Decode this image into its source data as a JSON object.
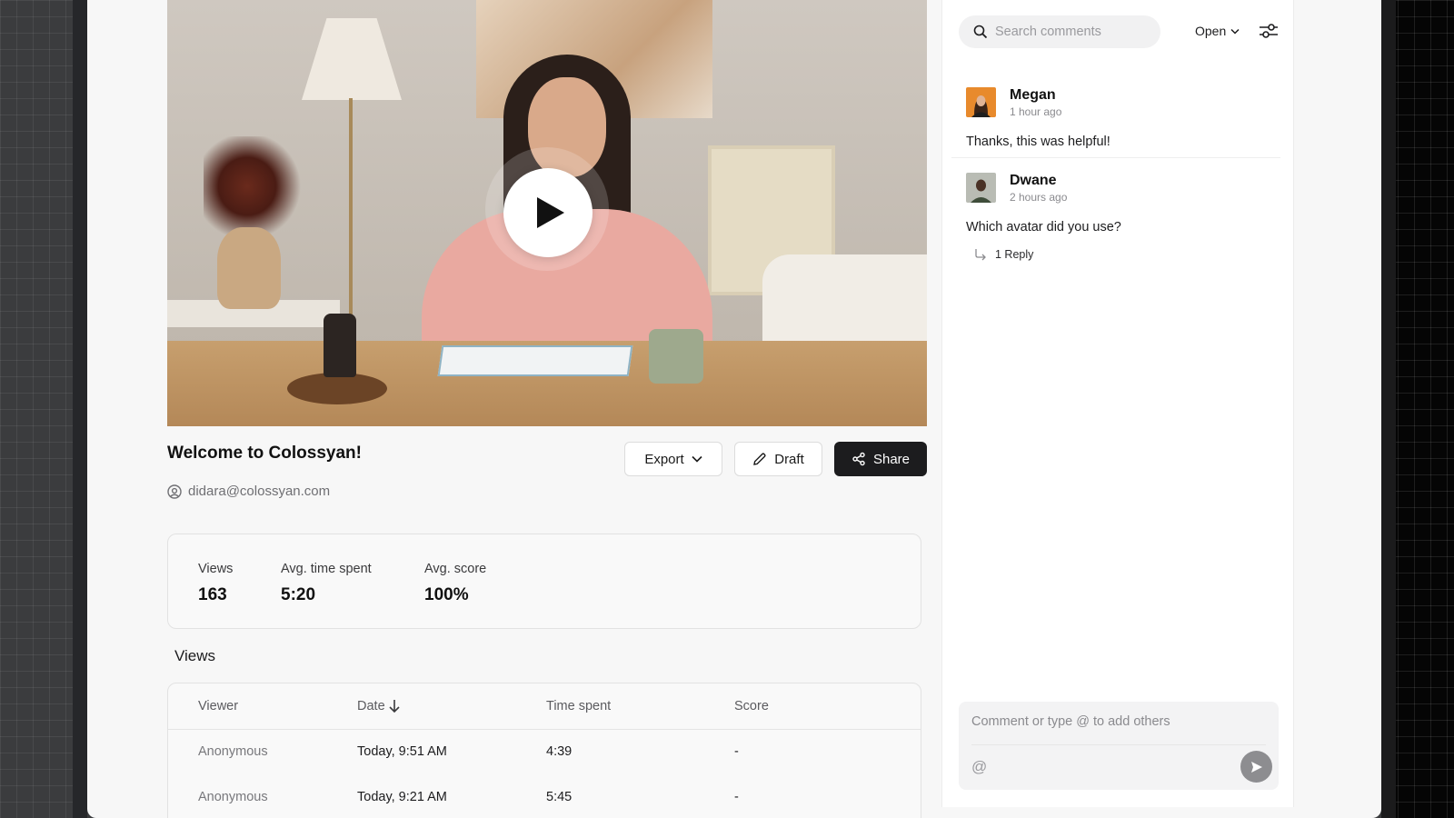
{
  "video": {
    "title": "Welcome to Colossyan!",
    "owner_email": "didara@colossyan.com"
  },
  "actions": {
    "export_label": "Export",
    "draft_label": "Draft",
    "share_label": "Share"
  },
  "stats": [
    {
      "label": "Views",
      "value": "163"
    },
    {
      "label": "Avg. time spent",
      "value": "5:20"
    },
    {
      "label": "Avg. score",
      "value": "100%"
    }
  ],
  "views_section": {
    "title": "Views",
    "columns": [
      "Viewer",
      "Date",
      "Time spent",
      "Score"
    ],
    "rows": [
      {
        "viewer": "Anonymous",
        "date": "Today, 9:51 AM",
        "time_spent": "4:39",
        "score": "-"
      },
      {
        "viewer": "Anonymous",
        "date": "Today, 9:21 AM",
        "time_spent": "5:45",
        "score": "-"
      }
    ]
  },
  "comments_panel": {
    "search_placeholder": "Search comments",
    "filter_label": "Open",
    "comments": [
      {
        "author": "Megan",
        "time": "1 hour ago",
        "text": "Thanks, this was helpful!"
      },
      {
        "author": "Dwane",
        "time": "2 hours ago",
        "text": "Which avatar did you use?",
        "replies": "1 Reply"
      }
    ],
    "composer_placeholder": "Comment or type @ to add others",
    "mention_symbol": "@"
  },
  "colors": {
    "share_bg": "#1c1c1e",
    "panel_bg": "#ffffff",
    "page_bg": "#f7f7f7"
  }
}
